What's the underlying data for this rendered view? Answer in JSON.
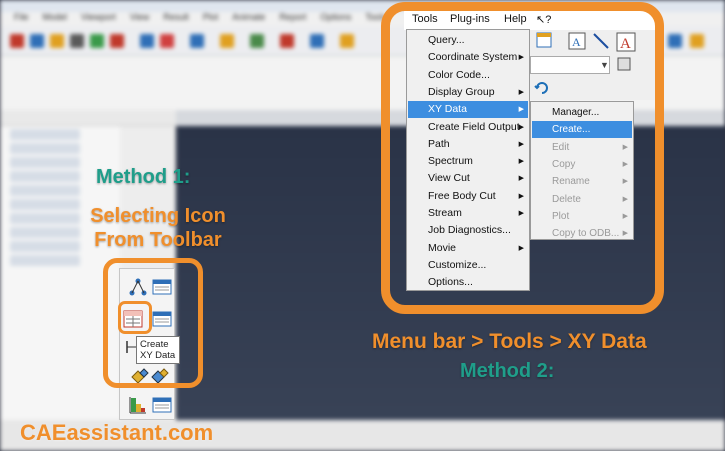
{
  "background_menu": [
    "File",
    "Model",
    "Viewport",
    "View",
    "Result",
    "Plot",
    "Animate",
    "Report",
    "Options",
    "Tools"
  ],
  "method1": {
    "title": "Method 1:",
    "subtitle_line1": "Selecting Icon",
    "subtitle_line2": "From Toolbar",
    "tooltip_line1": "Create",
    "tooltip_line2": "XY Data"
  },
  "menubar": {
    "tools": "Tools",
    "plugins": "Plug-ins",
    "help": "Help",
    "whatsthis": "↖?"
  },
  "tools_menu": [
    {
      "label": "Query...",
      "submenu": false,
      "active": false
    },
    {
      "label": "Coordinate System",
      "submenu": true,
      "active": false
    },
    {
      "label": "Color Code...",
      "submenu": false,
      "active": false
    },
    {
      "label": "Display Group",
      "submenu": true,
      "active": false
    },
    {
      "label": "XY Data",
      "submenu": true,
      "active": true
    },
    {
      "label": "Create Field Output",
      "submenu": true,
      "active": false
    },
    {
      "label": "Path",
      "submenu": true,
      "active": false
    },
    {
      "label": "Spectrum",
      "submenu": true,
      "active": false
    },
    {
      "label": "View Cut",
      "submenu": true,
      "active": false
    },
    {
      "label": "Free Body Cut",
      "submenu": true,
      "active": false
    },
    {
      "label": "Stream",
      "submenu": true,
      "active": false
    },
    {
      "label": "Job Diagnostics...",
      "submenu": false,
      "active": false
    },
    {
      "label": "Movie",
      "submenu": true,
      "active": false
    },
    {
      "label": "Customize...",
      "submenu": false,
      "active": false
    },
    {
      "label": "Options...",
      "submenu": false,
      "active": false
    }
  ],
  "xy_submenu": [
    {
      "label": "Manager...",
      "submenu": false,
      "active": false,
      "disabled": false
    },
    {
      "label": "Create...",
      "submenu": false,
      "active": true,
      "disabled": false
    },
    {
      "label": "Edit",
      "submenu": true,
      "active": false,
      "disabled": true
    },
    {
      "label": "Copy",
      "submenu": true,
      "active": false,
      "disabled": true
    },
    {
      "label": "Rename",
      "submenu": true,
      "active": false,
      "disabled": true
    },
    {
      "label": "Delete",
      "submenu": true,
      "active": false,
      "disabled": true
    },
    {
      "label": "Plot",
      "submenu": true,
      "active": false,
      "disabled": true
    },
    {
      "label": "Copy to ODB...",
      "submenu": true,
      "active": false,
      "disabled": true
    }
  ],
  "method2": {
    "path": "Menu bar > Tools > XY Data",
    "title": "Method 2:"
  },
  "brand": "CAEassistant.com",
  "colors": {
    "accent_orange": "#f08f2c",
    "accent_teal": "#1f9e8a",
    "menu_highlight": "#3d8ee0"
  }
}
